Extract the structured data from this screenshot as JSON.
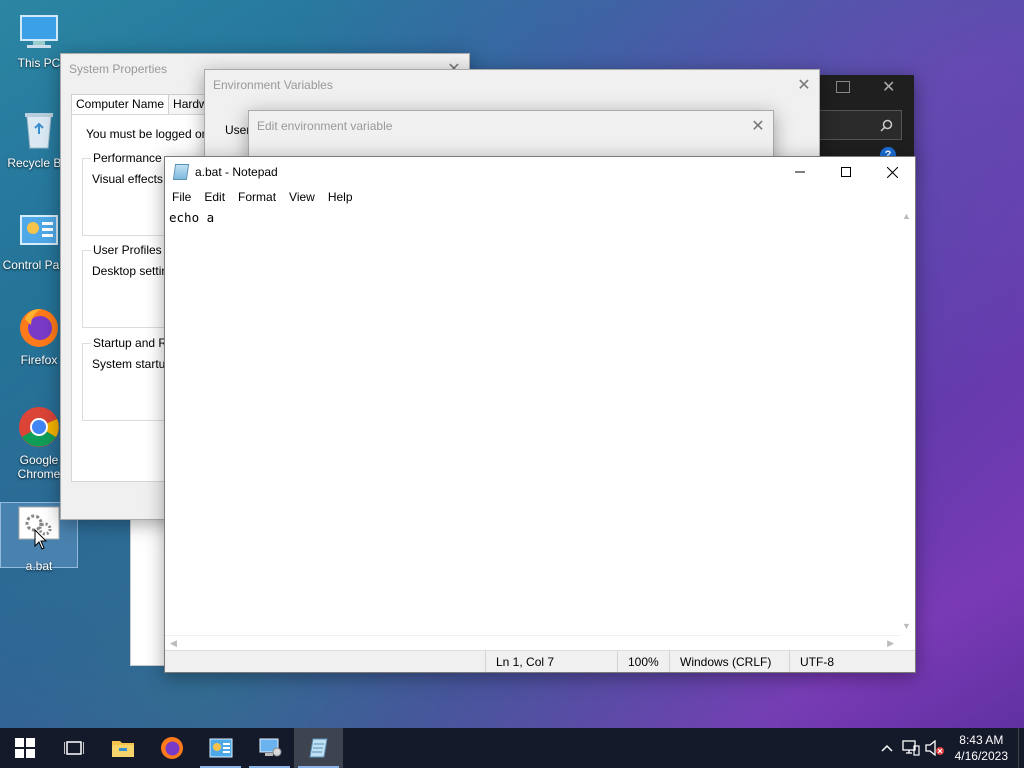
{
  "desktop": {
    "icons": [
      {
        "label": "This PC"
      },
      {
        "label": "Recycle Bin"
      },
      {
        "label": "Control Panel"
      },
      {
        "label": "Firefox"
      },
      {
        "label": "Google Chrome"
      },
      {
        "label": "a.bat"
      }
    ]
  },
  "system_properties": {
    "title": "System Properties",
    "tabs": [
      "Computer Name",
      "Hardware"
    ],
    "notice": "You must be logged on as an Administrator to make most of these changes.",
    "groups": [
      {
        "title": "Performance",
        "body": "Visual effects, processor scheduling, memory usage, and virtual memory"
      },
      {
        "title": "User Profiles",
        "body": "Desktop settings related to your sign-in"
      },
      {
        "title": "Startup and Recovery",
        "body": "System startup, system failure, and debugging information"
      }
    ]
  },
  "environment_variables": {
    "title": "Environment Variables",
    "user_label": "User variables"
  },
  "edit_env_var": {
    "title": "Edit environment variable"
  },
  "notepad": {
    "title": "a.bat - Notepad",
    "menu": [
      "File",
      "Edit",
      "Format",
      "View",
      "Help"
    ],
    "content": "echo a",
    "status": {
      "position": "Ln 1, Col 7",
      "zoom": "100%",
      "line_endings": "Windows (CRLF)",
      "encoding": "UTF-8"
    }
  },
  "taskbar": {
    "time": "8:43 AM",
    "date": "4/16/2023",
    "pinned": [
      "start-button",
      "task-view",
      "file-explorer",
      "firefox",
      "control-panel",
      "system-properties",
      "notepad"
    ],
    "accent_color": "#8ab4e8"
  }
}
